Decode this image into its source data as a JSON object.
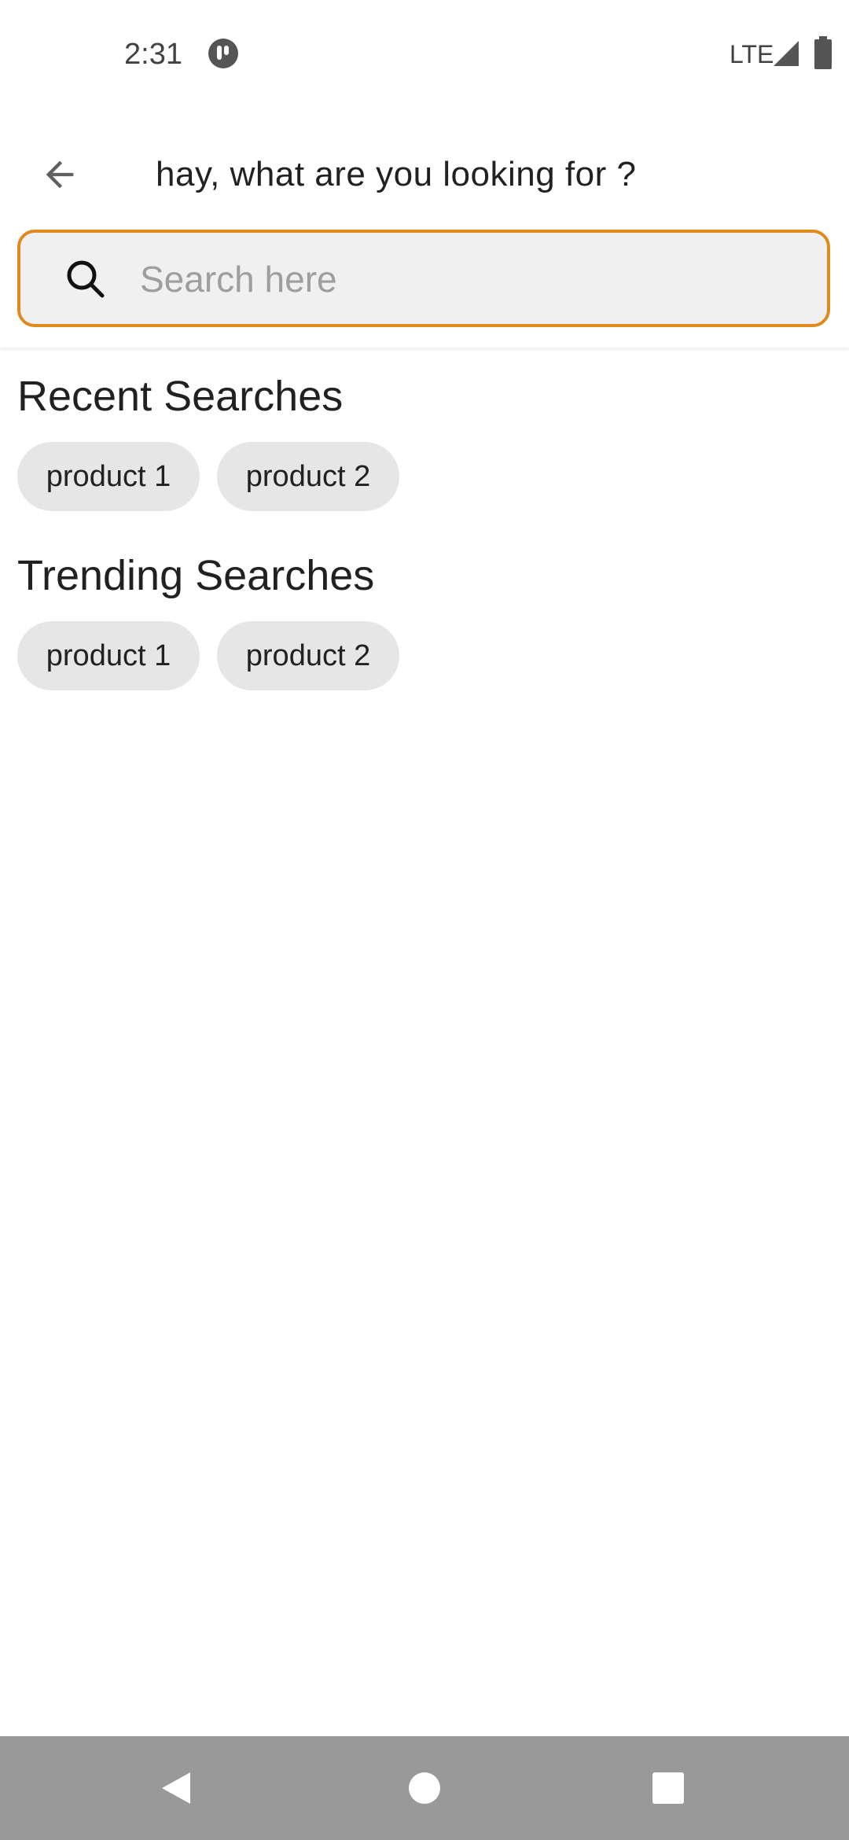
{
  "status_bar": {
    "time": "2:31",
    "network": "LTE",
    "icons": [
      "app-notification-icon",
      "signal-icon",
      "battery-icon"
    ]
  },
  "header": {
    "back_icon": "arrow-back-icon",
    "title": "hay, what are you looking for ?"
  },
  "search": {
    "icon": "search-icon",
    "placeholder": "Search here",
    "value": "",
    "border_color": "#e08a1e"
  },
  "recent": {
    "title": "Recent Searches",
    "chips": [
      "product 1",
      "product 2"
    ]
  },
  "trending": {
    "title": "Trending Searches",
    "chips": [
      "product 1",
      "product 2"
    ]
  },
  "nav_bar": {
    "buttons": [
      "back-triangle-icon",
      "home-circle-icon",
      "recents-square-icon"
    ]
  }
}
